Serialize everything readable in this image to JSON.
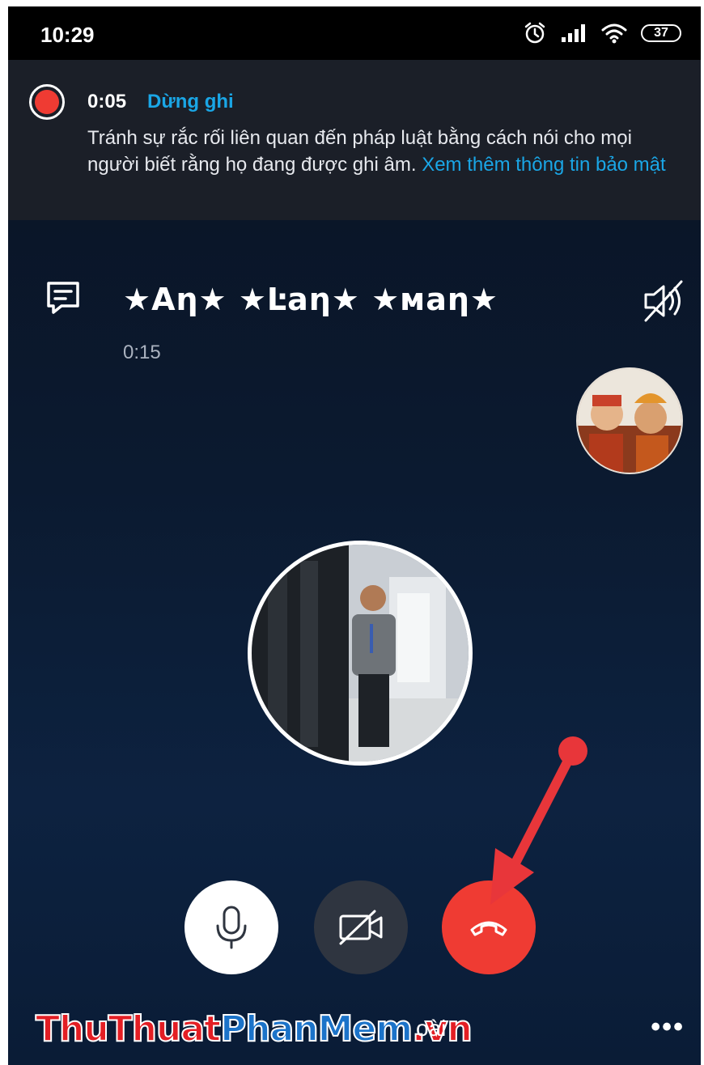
{
  "status_bar": {
    "time": "10:29",
    "battery": "37",
    "icons": [
      "alarm-icon",
      "signal-icon",
      "wifi-icon",
      "battery-icon"
    ]
  },
  "recording": {
    "elapsed": "0:05",
    "stop_label": "Dừng ghi",
    "message": "Tránh sự rắc rối liên quan đến pháp luật bằng cách nói cho mọi người biết rằng họ đang được ghi âm. ",
    "link": "Xem thêm thông tin bảo mật"
  },
  "call": {
    "caller_name": "★Aη★ ★Ŀaη★ ★мaη★",
    "duration": "0:15"
  },
  "controls": {
    "mic": "microphone-icon",
    "video": "video-off-icon",
    "hangup": "hang-up-icon"
  },
  "bottom": {
    "label_fragment": "oài",
    "more": "•••"
  },
  "watermark": {
    "part1": "ThuThuat",
    "part2": "PhanMem",
    "part3": ".vn"
  },
  "colors": {
    "accent_link": "#1aa6e6",
    "record_red": "#ef3b33",
    "hangup_red": "#ef3b33",
    "arrow_red": "#e8363a"
  }
}
